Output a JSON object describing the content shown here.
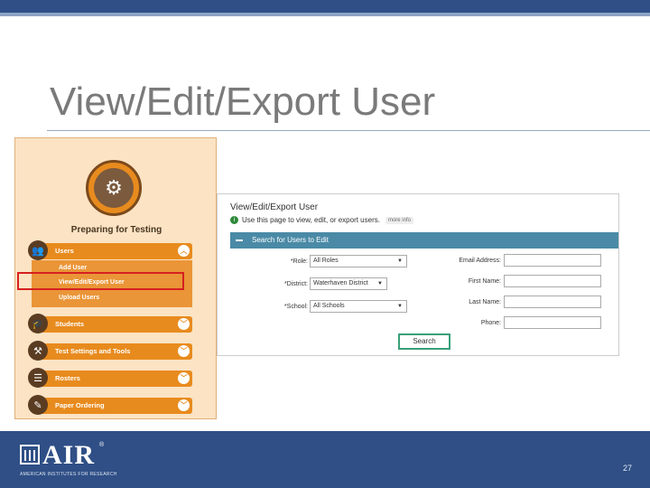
{
  "slide": {
    "title": "View/Edit/Export User",
    "page_number": "27"
  },
  "left_panel": {
    "hero_title": "Preparing for Testing",
    "nav": [
      {
        "label": "Users",
        "icon": "users-icon",
        "expanded": true
      },
      {
        "label": "Students",
        "icon": "graduation-cap-icon"
      },
      {
        "label": "Test Settings and Tools",
        "icon": "tools-icon"
      },
      {
        "label": "Rosters",
        "icon": "roster-icon"
      },
      {
        "label": "Paper Ordering",
        "icon": "paper-icon"
      }
    ],
    "users_sub": [
      "Add User",
      "View/Edit/Export User",
      "Upload Users"
    ]
  },
  "right_panel": {
    "title": "View/Edit/Export User",
    "info_text": "Use this page to view, edit, or export users.",
    "more_info": "more info",
    "section_label": "Search for Users to Edit",
    "fields": {
      "role_label": "*Role:",
      "role_value": "All Roles",
      "district_label": "*District:",
      "district_value": "Waterhaven District",
      "school_label": "*School:",
      "school_value": "All Schools",
      "email_label": "Email Address:",
      "first_label": "First Name:",
      "last_label": "Last Name:",
      "phone_label": "Phone:"
    },
    "search_button": "Search"
  },
  "footer": {
    "logo_text": "AIR",
    "logo_reg": "®",
    "logo_sub": "AMERICAN INSTITUTES FOR RESEARCH"
  }
}
